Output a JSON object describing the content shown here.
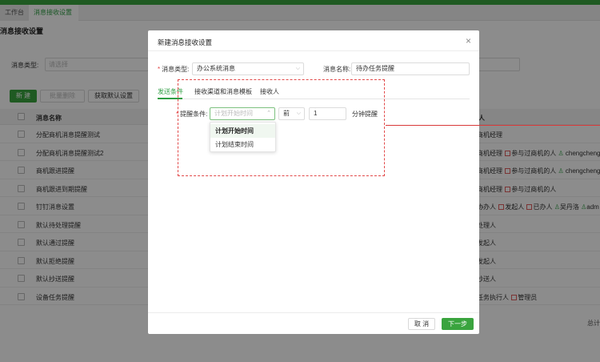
{
  "tabs": {
    "home": "工作台",
    "active": "消息接收设置",
    "close": "×"
  },
  "page_title": "消息接收设置",
  "filter": {
    "label": "消息类型:",
    "placeholder": "请选择"
  },
  "buttons": {
    "new": "新 建",
    "batch_delete": "批量删除",
    "get_default": "获取默认设置"
  },
  "table": {
    "header": {
      "name": "消息名称",
      "receiver": "人"
    },
    "rows": [
      {
        "name": "分配商机消息提醒测试",
        "receiver": "商机经理"
      },
      {
        "name": "分配商机消息提醒测试2",
        "receiver_parts": [
          "商机经理",
          "参与过商机的人",
          "chengcheng"
        ]
      },
      {
        "name": "商机跟进提醒",
        "receiver_parts": [
          "商机经理",
          "参与过商机的人",
          "chengcheng"
        ]
      },
      {
        "name": "商机跟进到期提醒",
        "receiver_parts": [
          "商机经理",
          "参与过商机的人"
        ]
      },
      {
        "name": "钉钉消息设置",
        "receiver_parts": [
          "协办人",
          "发起人",
          "已办人",
          "吴丹洛",
          "adm"
        ]
      },
      {
        "name": "默认待处理提醒",
        "receiver": "处理人"
      },
      {
        "name": "默认通过提醒",
        "receiver": "发起人"
      },
      {
        "name": "默认拒绝提醒",
        "receiver": "发起人"
      },
      {
        "name": "默认抄送提醒",
        "receiver": "抄送人"
      },
      {
        "name": "设备任务提醒",
        "receiver_parts": [
          "任务执行人",
          "管理员"
        ]
      }
    ],
    "total": "总计"
  },
  "modal": {
    "title": "新建消息接收设置",
    "close": "×",
    "message_type": {
      "label": "消息类型:",
      "value": "办公系统消息"
    },
    "message_name": {
      "label": "消息名称:",
      "value": "待办任务提醒"
    },
    "subtabs": [
      "发送条件",
      "接收渠道和消息模板",
      "接收人"
    ],
    "condition": {
      "label": "提醒条件:",
      "placeholder": "计划开始时间",
      "direction": "前",
      "amount": "1",
      "unit": "分钟提醒"
    },
    "dropdown": [
      "计划开始时间",
      "计划结束时间"
    ],
    "footer": {
      "cancel": "取 消",
      "next": "下一步"
    }
  },
  "colors": {
    "accent": "#3aa43e",
    "annotation": "#e24a4a"
  }
}
